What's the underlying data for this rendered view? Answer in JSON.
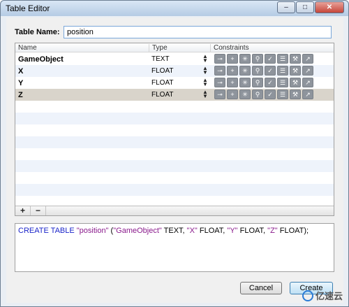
{
  "window": {
    "title": "Table Editor"
  },
  "title_controls": {
    "minimize": "–",
    "maximize": "□",
    "close": "✕"
  },
  "table_name": {
    "label": "Table Name:",
    "value": "position"
  },
  "columns_header": {
    "name": "Name",
    "type": "Type",
    "constraints": "Constraints"
  },
  "rows": [
    {
      "name": "GameObject",
      "type": "TEXT"
    },
    {
      "name": "X",
      "type": "FLOAT"
    },
    {
      "name": "Y",
      "type": "FLOAT"
    },
    {
      "name": "Z",
      "type": "FLOAT"
    }
  ],
  "constraint_icons": [
    "key-icon",
    "plus-icon",
    "asterisk-icon",
    "pin-icon",
    "check-icon",
    "list-icon",
    "wrench-icon",
    "external-link-icon"
  ],
  "grid_footer": {
    "add": "+",
    "remove": "−"
  },
  "sql": {
    "kw_create": "CREATE",
    "kw_table": "TABLE",
    "table": "\"position\"",
    "open": " (",
    "c1": "\"GameObject\"",
    "t1": " TEXT, ",
    "c2": "\"X\"",
    "t2": " FLOAT, ",
    "c3": "\"Y\"",
    "t3": " FLOAT, ",
    "c4": "\"Z\"",
    "t4": " FLOAT);"
  },
  "buttons": {
    "cancel": "Cancel",
    "create": "Create"
  },
  "watermark": {
    "text": "亿速云"
  },
  "colors": {
    "keyword": "#1a24c9",
    "string": "#8a1a8c",
    "selected_row": "#d9d4cb"
  }
}
